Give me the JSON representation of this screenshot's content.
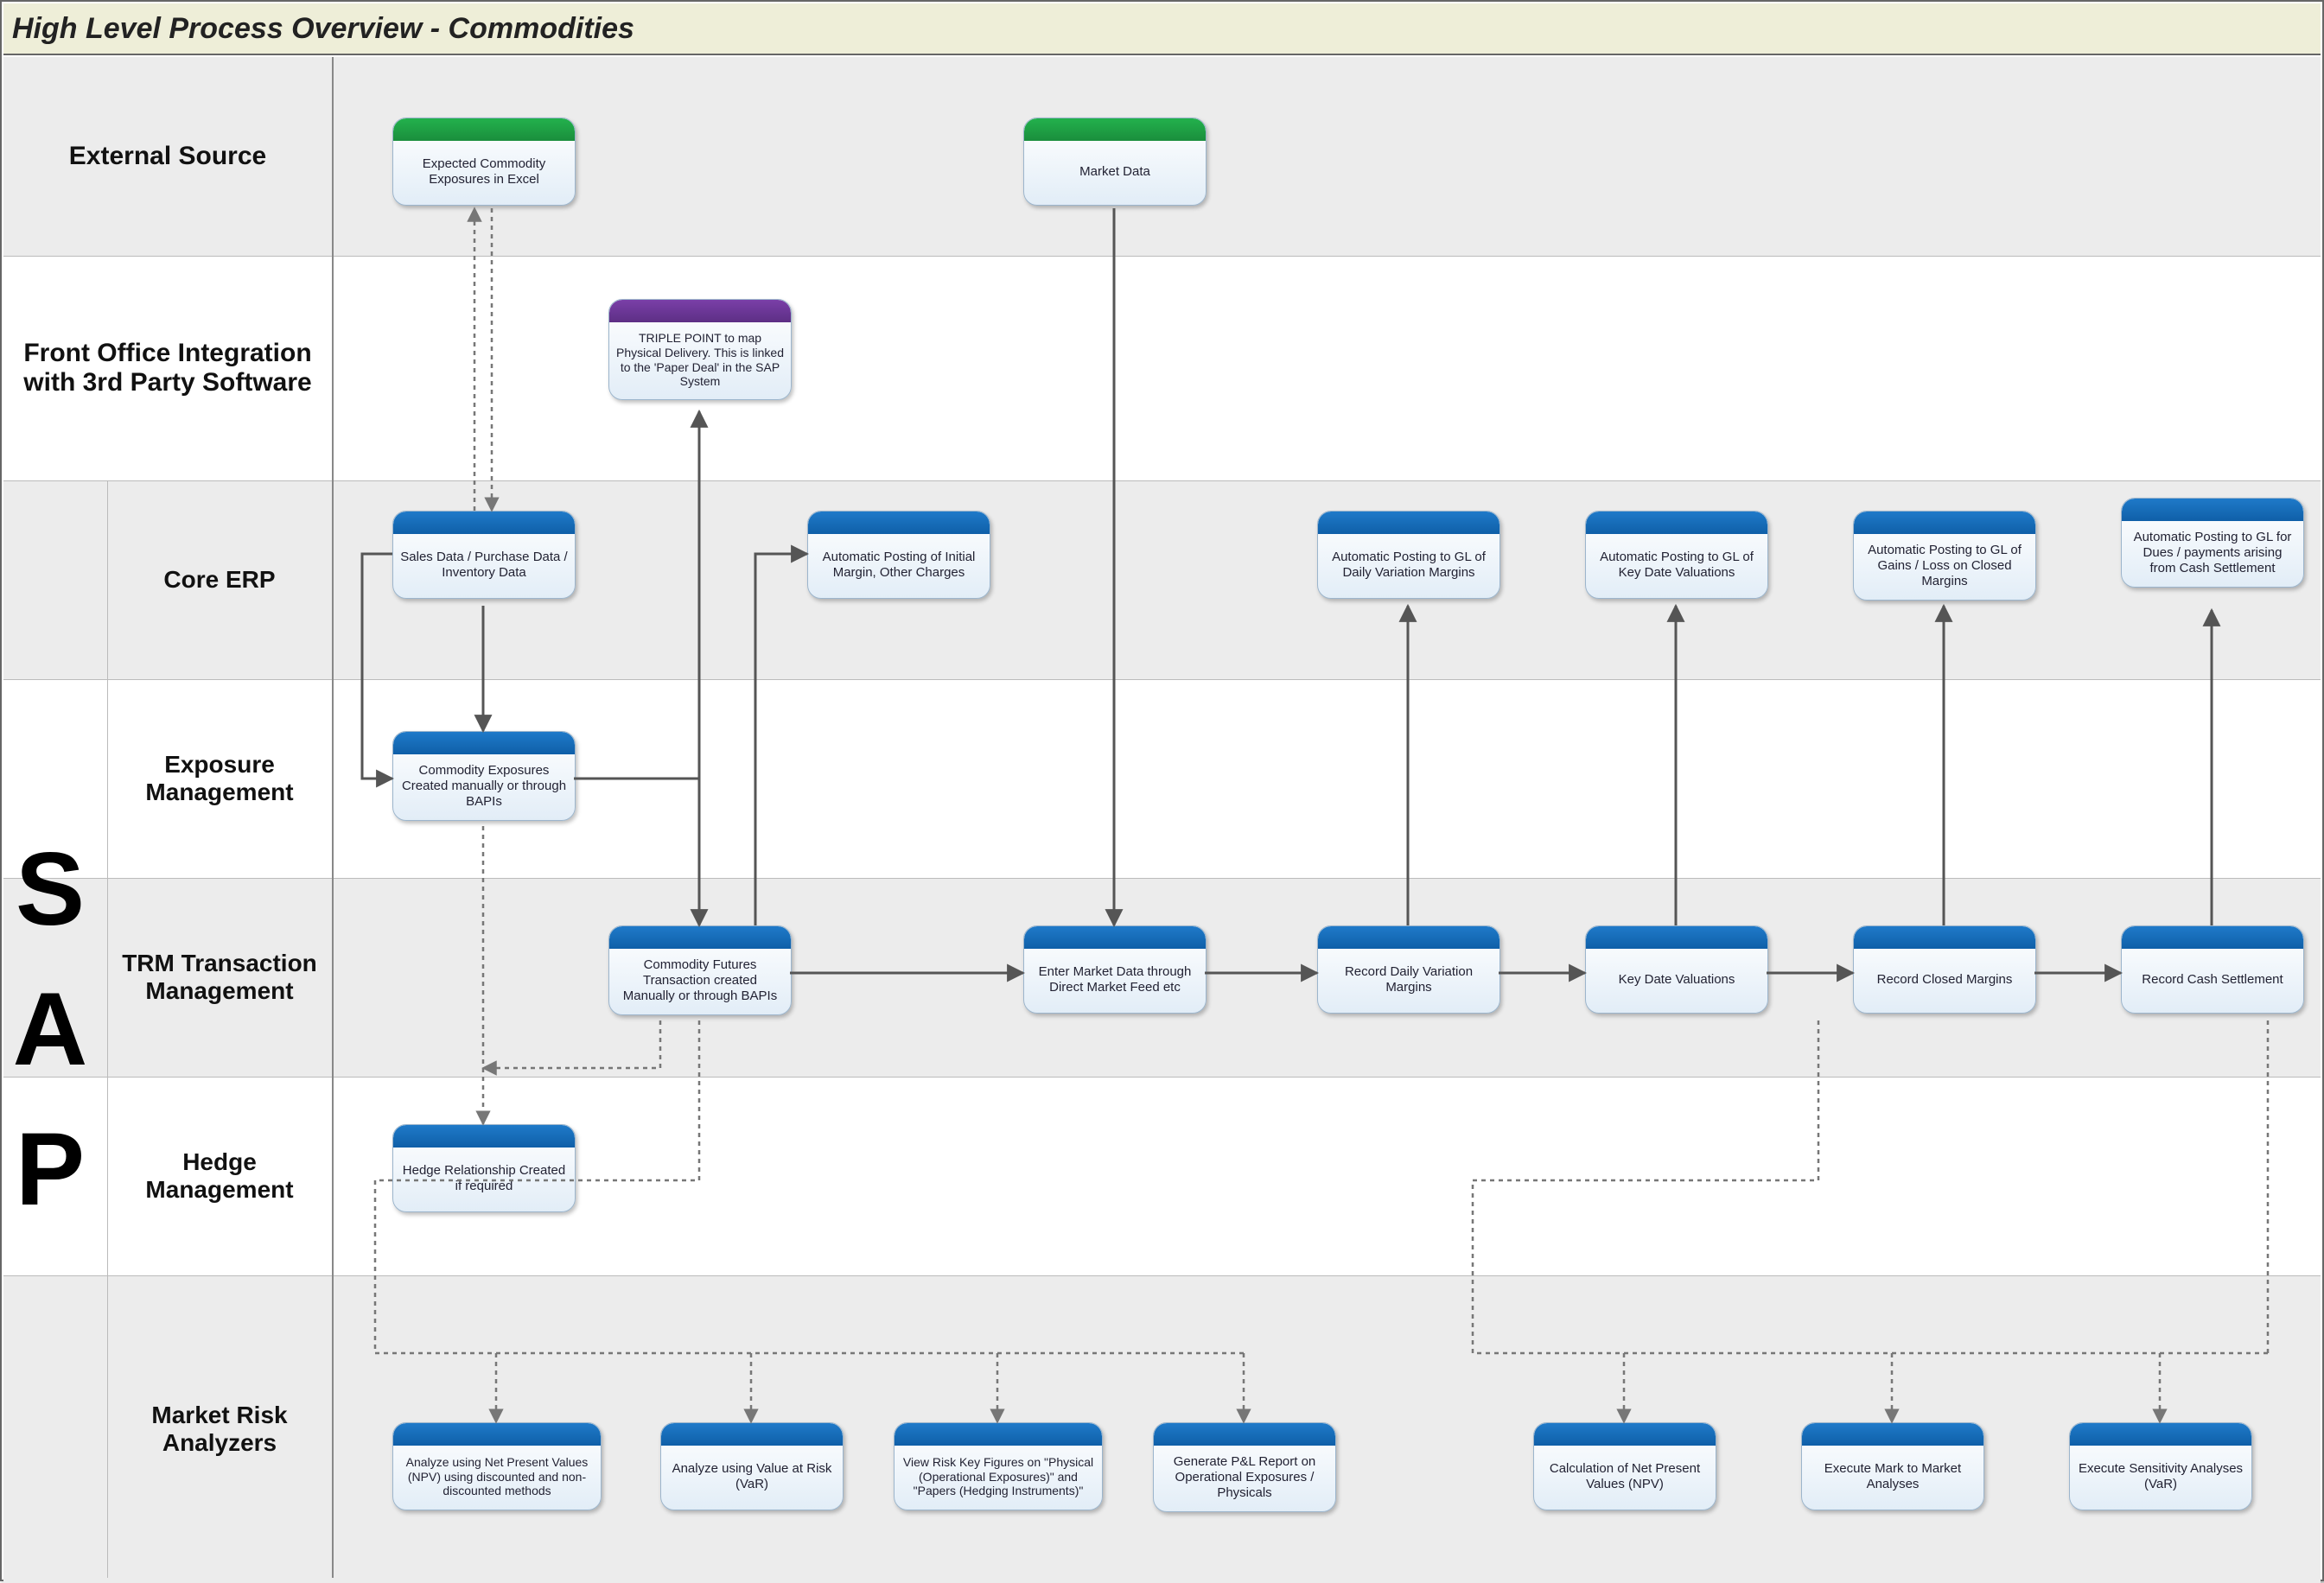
{
  "title": "High Level Process Overview  - Commodities",
  "sap_label": "S\nA\nP",
  "lanes": {
    "external_source": "External Source",
    "front_office": "Front Office Integration with 3rd Party Software",
    "core_erp": "Core ERP",
    "exposure_mgmt": "Exposure Management",
    "trm": "TRM Transaction Management",
    "hedge_mgmt": "Hedge Management",
    "market_risk": "Market Risk Analyzers"
  },
  "boxes": {
    "ext_expected": "Expected Commodity Exposures in Excel",
    "ext_market_data": "Market Data",
    "fo_triple_point": "TRIPLE POINT to map Physical Delivery. This is linked to the 'Paper Deal' in the SAP System",
    "erp_sales": "Sales Data / Purchase Data / Inventory Data",
    "erp_auto_initial_margin": "Automatic Posting of Initial Margin, Other Charges",
    "erp_auto_daily_var": "Automatic Posting to GL of Daily Variation Margins",
    "erp_auto_key_date": "Automatic Posting to GL of Key Date Valuations",
    "erp_auto_gains_loss": "Automatic Posting to GL of Gains / Loss on Closed Margins",
    "erp_auto_dues": "Automatic Posting to GL for Dues / payments arising from Cash Settlement",
    "exp_commodity": "Commodity Exposures Created manually or through BAPIs",
    "trm_futures": "Commodity Futures Transaction created Manually or through BAPIs",
    "trm_enter_market": "Enter Market Data through Direct Market Feed etc",
    "trm_record_daily": "Record Daily Variation Margins",
    "trm_key_date": "Key Date Valuations",
    "trm_record_closed": "Record Closed Margins",
    "trm_record_cash": "Record Cash Settlement",
    "hedge_rel": "Hedge Relationship Created if required",
    "mr_npv_analyze": "Analyze using Net Present Values (NPV) using discounted and non-discounted methods",
    "mr_var": "Analyze using Value at Risk (VaR)",
    "mr_key_figures": "View Risk Key Figures on \"Physical (Operational Exposures)\" and \"Papers (Hedging Instruments)\"",
    "mr_pnl": "Generate P&L Report on Operational Exposures / Physicals",
    "mr_npv_calc": "Calculation of Net Present Values (NPV)",
    "mr_mark_market": "Execute Mark to Market Analyses",
    "mr_sensitivity": "Execute Sensitivity Analyses (VaR)"
  }
}
